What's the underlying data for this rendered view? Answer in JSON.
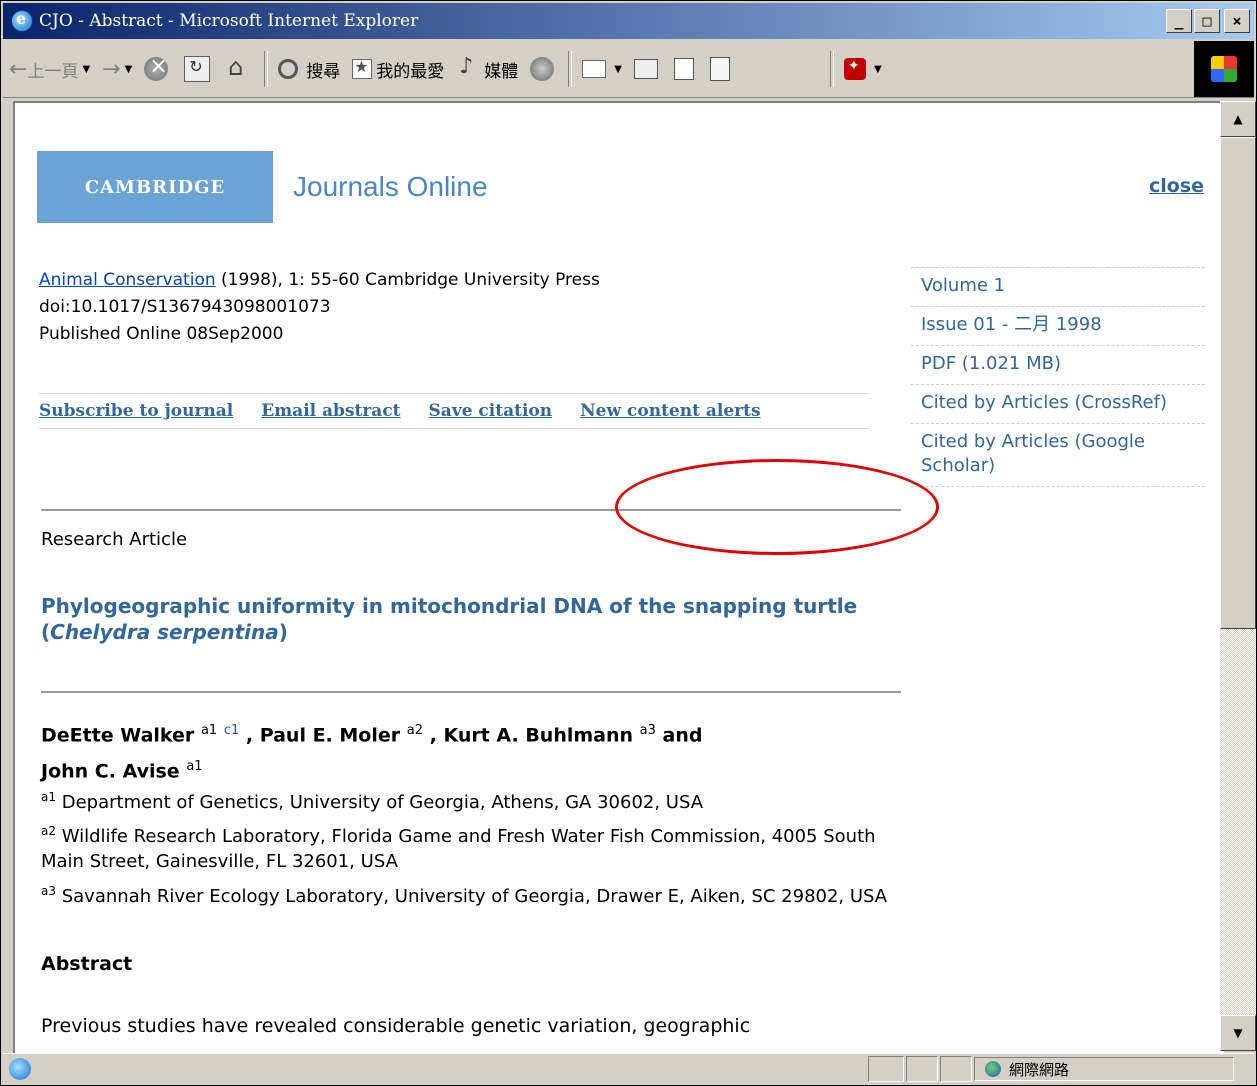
{
  "window": {
    "title": "CJO - Abstract - Microsoft Internet Explorer"
  },
  "toolbar": {
    "back": "上一頁",
    "search": "搜尋",
    "favorites": "我的最愛",
    "media": "媒體"
  },
  "page": {
    "brand": {
      "logo": "CAMBRIDGE",
      "product": "Journals Online"
    },
    "close": "close",
    "citation": {
      "journal": "Animal Conservation",
      "details": " (1998), 1: 55-60 Cambridge University Press",
      "doi": "doi:10.1017/S1367943098001073",
      "published": "Published Online 08Sep2000"
    },
    "actions": [
      "Subscribe to journal",
      "Email abstract",
      "Save citation",
      "New content alerts"
    ],
    "article_type": "Research Article",
    "title_prefix": "Phylogeographic uniformity in mitochondrial DNA of the snapping turtle (",
    "title_italic": "Chelydra serpentina",
    "title_suffix": ")",
    "authors": [
      {
        "name": "DeEtte  Walker",
        "sup": "a1",
        "sup2": "c1",
        "sep": " , "
      },
      {
        "name": "Paul E.  Moler",
        "sup": "a2",
        "sep": " , "
      },
      {
        "name": "Kurt A.  Buhlmann",
        "sup": "a3",
        "sep": " and "
      },
      {
        "name": "John C.  Avise",
        "sup": "a1"
      }
    ],
    "affiliations": [
      {
        "sup": "a1",
        "text": " Department of Genetics, University of Georgia, Athens, GA 30602, USA"
      },
      {
        "sup": "a2",
        "text": " Wildlife Research Laboratory, Florida Game and Fresh Water Fish Commission, 4005 South Main Street, Gainesville, FL 32601, USA"
      },
      {
        "sup": "a3",
        "text": " Savannah River Ecology Laboratory, University of Georgia, Drawer E, Aiken, SC 29802, USA"
      }
    ],
    "abstract_heading": "Abstract",
    "abstract_text": "Previous studies have revealed considerable genetic variation, geographic"
  },
  "sidebar": {
    "items": [
      "Volume 1",
      "Issue 01 - 二月 1998",
      "PDF (1.021 MB)",
      "Cited by Articles (CrossRef)",
      "Cited by Articles (Google Scholar)"
    ]
  },
  "statusbar": {
    "zone": "網際網路"
  },
  "colors": {
    "link": "#336699",
    "logo_bg": "#6ba3d6",
    "annotation": "#e00000"
  }
}
